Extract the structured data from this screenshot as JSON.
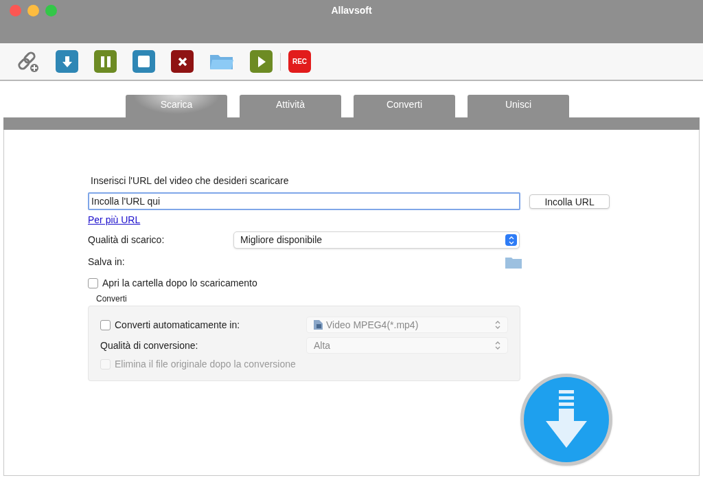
{
  "window": {
    "title": "Allavsoft"
  },
  "toolbar": {
    "record_label": "REC"
  },
  "tabs": [
    {
      "label": "Scarica",
      "selected": true
    },
    {
      "label": "Attività",
      "selected": false
    },
    {
      "label": "Converti",
      "selected": false
    },
    {
      "label": "Unisci",
      "selected": false
    }
  ],
  "url": {
    "label": "Inserisci l'URL del video che desideri scaricare",
    "value": "Incolla l'URL qui",
    "paste_button": "Incolla URL",
    "multi_link": "Per più URL"
  },
  "quality": {
    "label": "Qualità di scarico:",
    "value": "Migliore disponibile"
  },
  "save": {
    "label": "Salva in:"
  },
  "open_folder": {
    "label": "Apri la cartella dopo lo scaricamento",
    "checked": false
  },
  "convert": {
    "title": "Converti",
    "auto": {
      "label": "Converti automaticamente in:",
      "checked": false
    },
    "format": {
      "value": "Video MPEG4(*.mp4)",
      "disabled": true
    },
    "quality": {
      "label": "Qualità di conversione:",
      "value": "Alta",
      "disabled": true
    },
    "delete_original": {
      "label": "Elimina il file originale dopo la conversione",
      "checked": false,
      "disabled": true
    }
  }
}
